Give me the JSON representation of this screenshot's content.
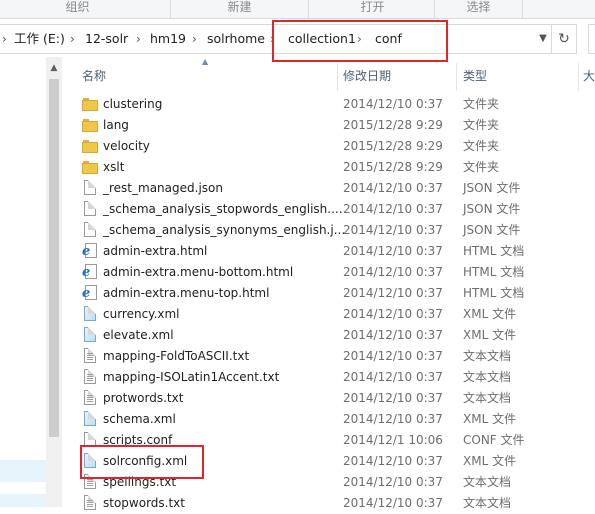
{
  "ribbon": {
    "groups": [
      "组织",
      "新建",
      "打开",
      "选择"
    ]
  },
  "address": {
    "crumbs": [
      "工作 (E:)",
      "12-solr",
      "hm19",
      "solrhome",
      "collection1",
      "conf"
    ],
    "dropdown_icon": "chevron-down-icon",
    "refresh_icon": "refresh-icon"
  },
  "columns": {
    "name": "名称",
    "modified": "修改日期",
    "type": "类型",
    "size": "大"
  },
  "files": [
    {
      "name": "clustering",
      "date": "2014/12/10 0:37",
      "type": "文件夹",
      "icon": "folder-icon"
    },
    {
      "name": "lang",
      "date": "2015/12/28 9:29",
      "type": "文件夹",
      "icon": "folder-icon"
    },
    {
      "name": "velocity",
      "date": "2015/12/28 9:29",
      "type": "文件夹",
      "icon": "folder-icon"
    },
    {
      "name": "xslt",
      "date": "2015/12/28 9:29",
      "type": "文件夹",
      "icon": "folder-icon"
    },
    {
      "name": "_rest_managed.json",
      "date": "2014/12/10 0:37",
      "type": "JSON 文件",
      "icon": "document-icon"
    },
    {
      "name": "_schema_analysis_stopwords_english....",
      "date": "2014/12/10 0:37",
      "type": "JSON 文件",
      "icon": "document-icon"
    },
    {
      "name": "_schema_analysis_synonyms_english.j...",
      "date": "2014/12/10 0:37",
      "type": "JSON 文件",
      "icon": "document-icon"
    },
    {
      "name": "admin-extra.html",
      "date": "2014/12/10 0:37",
      "type": "HTML 文档",
      "icon": "html-file-icon"
    },
    {
      "name": "admin-extra.menu-bottom.html",
      "date": "2014/12/10 0:37",
      "type": "HTML 文档",
      "icon": "html-file-icon"
    },
    {
      "name": "admin-extra.menu-top.html",
      "date": "2014/12/10 0:37",
      "type": "HTML 文档",
      "icon": "html-file-icon"
    },
    {
      "name": "currency.xml",
      "date": "2014/12/10 0:37",
      "type": "XML 文件",
      "icon": "xml-file-icon"
    },
    {
      "name": "elevate.xml",
      "date": "2014/12/10 0:37",
      "type": "XML 文件",
      "icon": "xml-file-icon"
    },
    {
      "name": "mapping-FoldToASCII.txt",
      "date": "2014/12/10 0:37",
      "type": "文本文档",
      "icon": "text-file-icon"
    },
    {
      "name": "mapping-ISOLatin1Accent.txt",
      "date": "2014/12/10 0:37",
      "type": "文本文档",
      "icon": "text-file-icon"
    },
    {
      "name": "protwords.txt",
      "date": "2014/12/10 0:37",
      "type": "文本文档",
      "icon": "text-file-icon"
    },
    {
      "name": "schema.xml",
      "date": "2014/12/10 0:37",
      "type": "XML 文件",
      "icon": "xml-file-icon"
    },
    {
      "name": "scripts.conf",
      "date": "2014/12/1 10:06",
      "type": "CONF 文件",
      "icon": "document-icon"
    },
    {
      "name": "solrconfig.xml",
      "date": "2014/12/10 0:37",
      "type": "XML 文件",
      "icon": "xml-file-icon"
    },
    {
      "name": "spellings.txt",
      "date": "2014/12/10 0:37",
      "type": "文本文档",
      "icon": "text-file-icon"
    },
    {
      "name": "stopwords.txt",
      "date": "2014/12/10 0:37",
      "type": "文本文档",
      "icon": "text-file-icon"
    }
  ],
  "colors": {
    "highlight_box": "#e0262b",
    "header_text": "#4c607a",
    "folder": "#f1c74a"
  }
}
